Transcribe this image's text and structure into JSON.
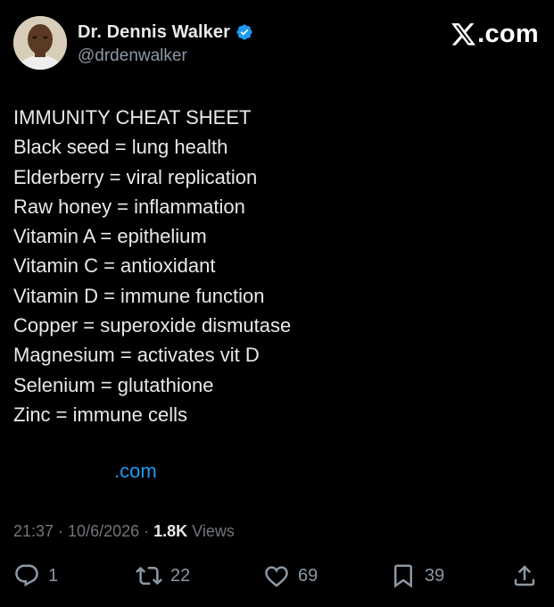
{
  "author": {
    "display_name": "Dr. Dennis Walker",
    "handle": "@drdenwalker",
    "verified": true
  },
  "brand": {
    "logo_icon": "x-logo-icon",
    "text": ".com"
  },
  "tweet": {
    "lines": [
      "IMMUNITY CHEAT SHEET",
      "Black seed = lung health",
      "Elderberry = viral replication",
      "Raw honey = inflammation",
      "Vitamin A = epithelium",
      "Vitamin C = antioxidant",
      "Vitamin D = immune function",
      "Copper = superoxide dismutase",
      "Magnesium = activates vit D",
      "Selenium = glutathione",
      "Zinc = immune cells"
    ],
    "link_text": ".com"
  },
  "meta": {
    "time": "21:37",
    "separator": " · ",
    "date": "10/6/2026",
    "views_count": "1.8K",
    "views_label": " Views"
  },
  "actions": {
    "replies": "1",
    "reposts": "22",
    "likes": "69",
    "bookmarks": "39"
  },
  "colors": {
    "background": "#000000",
    "text": "#e7e9ea",
    "secondary_text": "#71767b",
    "link": "#1d9bf0",
    "verified_badge": "#1d9bf0"
  }
}
